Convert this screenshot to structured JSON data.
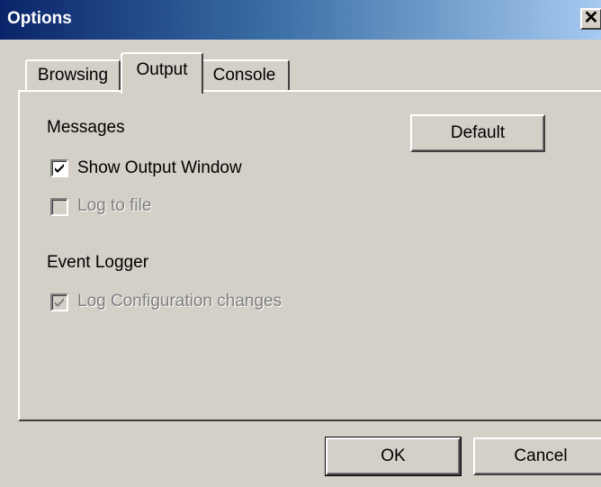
{
  "window": {
    "title": "Options",
    "close_glyph": "✕",
    "close_icon": "close-icon"
  },
  "tabs": [
    {
      "label": "Browsing",
      "active": false
    },
    {
      "label": "Output",
      "active": true
    },
    {
      "label": "Console",
      "active": false
    }
  ],
  "output": {
    "messages_heading": "Messages",
    "default_button": "Default",
    "show_output_window": {
      "label": "Show Output Window",
      "checked": true,
      "enabled": true
    },
    "log_to_file": {
      "label": "Log to file",
      "checked": false,
      "enabled": false
    },
    "event_logger_heading": "Event Logger",
    "log_config_changes": {
      "label": "Log Configuration changes",
      "checked": true,
      "enabled": false
    }
  },
  "footer": {
    "ok_label": "OK",
    "cancel_label": "Cancel"
  },
  "colors": {
    "face": "#d4d0c8",
    "title_start": "#0a246a",
    "title_end": "#a6caf0",
    "disabled_text": "#808080"
  }
}
